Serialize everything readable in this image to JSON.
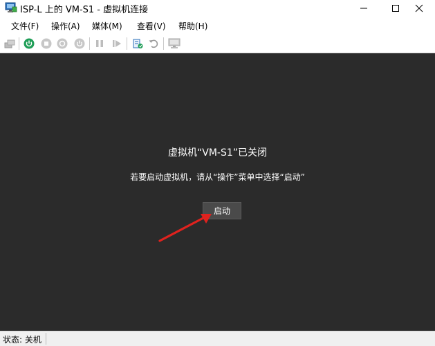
{
  "window": {
    "title": "ISP-L 上的 VM-S1 - 虚拟机连接",
    "app_icon": "vm-connect-icon"
  },
  "menu": {
    "items": [
      {
        "label": "文件(F)"
      },
      {
        "label": "操作(A)"
      },
      {
        "label": "媒体(M)"
      },
      {
        "label": "查看(V)"
      },
      {
        "label": "帮助(H)"
      }
    ]
  },
  "toolbar": {
    "icons": [
      "ctrl-alt-del-icon",
      "start-icon",
      "turn-off-icon",
      "shut-down-icon",
      "save-icon",
      "pause-icon",
      "reset-icon",
      "checkpoint-icon",
      "revert-icon",
      "enhanced-session-icon"
    ]
  },
  "console": {
    "title": "虚拟机“VM-S1”已关闭",
    "subtitle": "若要启动虚拟机，请从“操作”菜单中选择“启动”",
    "start_button": "启动",
    "annotation_color": "#e0221e"
  },
  "status": {
    "text": "状态: 关机"
  },
  "colors": {
    "console_bg": "#2b2b2b",
    "power_green": "#1f9e57",
    "annotation": "#e0221e"
  }
}
